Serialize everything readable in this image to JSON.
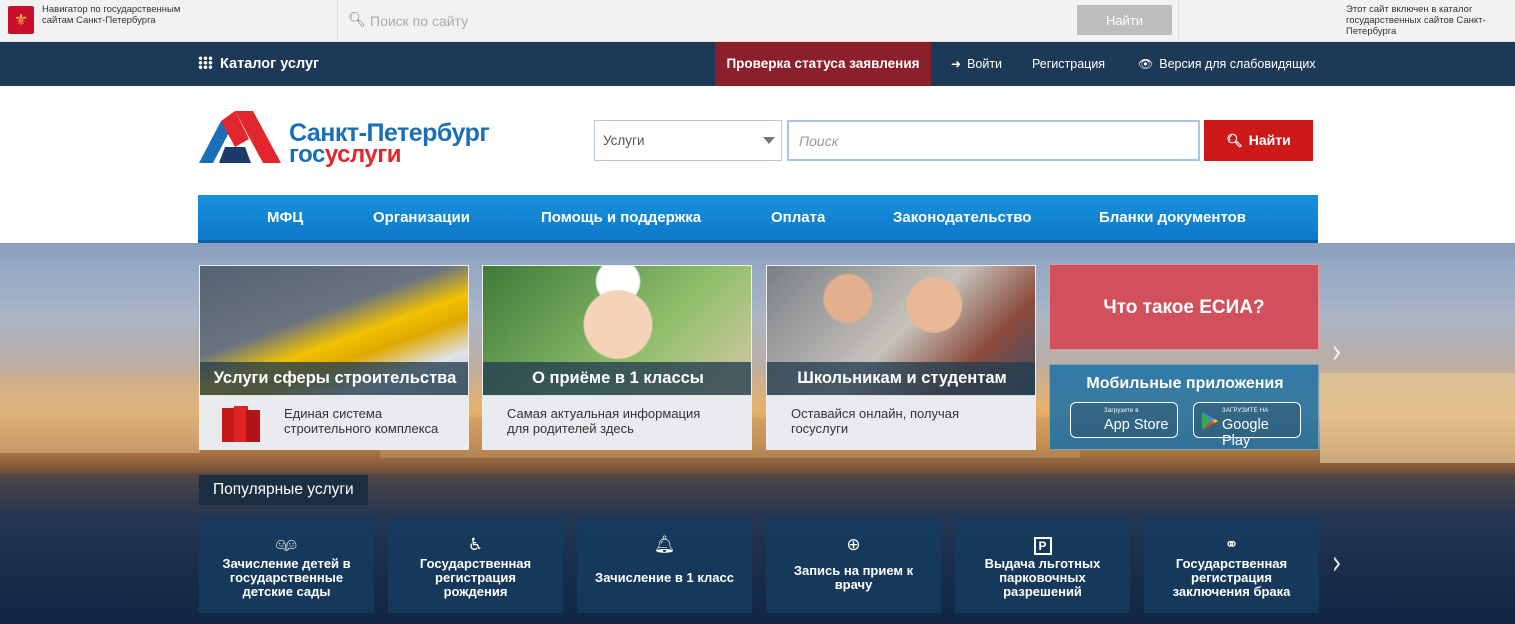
{
  "govbar": {
    "navigator_text": "Навигатор по государственным сайтам Санкт-Петербурга",
    "search_placeholder": "Поиск по сайту",
    "search_button": "Найти",
    "catalog_note": "Этот сайт включен в каталог государственных сайтов Санкт-Петербурга"
  },
  "topnav": {
    "catalog": "Каталог услуг",
    "status_check": "Проверка статуса заявления",
    "login": "Войти",
    "register": "Регистрация",
    "accessible": "Версия для слабовидящих"
  },
  "header": {
    "logo_line1": "Санкт-Петербург",
    "logo_line2_a": "гос",
    "logo_line2_b": "услуги",
    "select_value": "Услуги",
    "search_placeholder": "Поиск",
    "search_button": "Найти"
  },
  "mainnav": [
    "МФЦ",
    "Организации",
    "Помощь и поддержка",
    "Оплата",
    "Законодательство",
    "Бланки документов"
  ],
  "cards": [
    {
      "title": "Услуги сферы строительства",
      "desc1": "Единая система",
      "desc2": "строительного комплекса"
    },
    {
      "title": "О приёме в 1 классы",
      "desc1": "Самая актуальная информация",
      "desc2": "для родителей здесь"
    },
    {
      "title": "Школьникам и студентам",
      "desc1": "Оставайся онлайн, получая",
      "desc2": "госуслуги"
    }
  ],
  "esia": "Что такое ЕСИА?",
  "mobile": {
    "title": "Мобильные приложения",
    "appstore_small": "Загрузите в",
    "appstore": "App Store",
    "gplay_small": "ЗАГРУЗИТЕ НА",
    "gplay": "Google Play"
  },
  "popular": {
    "label": "Популярные услуги",
    "items": [
      {
        "icon": "children-icon",
        "lines": [
          "Зачисление детей в",
          "государственные",
          "детские сады"
        ]
      },
      {
        "icon": "stroller-icon",
        "lines": [
          "Государственная",
          "регистрация",
          "рождения"
        ]
      },
      {
        "icon": "bell-icon",
        "lines": [
          "Зачисление в 1 класс"
        ]
      },
      {
        "icon": "medical-bag-icon",
        "lines": [
          "Запись на прием к",
          "врачу"
        ]
      },
      {
        "icon": "parking-icon",
        "lines": [
          "Выдача льготных",
          "парковочных",
          "разрешений"
        ]
      },
      {
        "icon": "rings-icon",
        "lines": [
          "Государственная",
          "регистрация",
          "заключения брака"
        ]
      }
    ]
  },
  "colors": {
    "brand_blue": "#1b6eb8",
    "brand_red": "#e1262c",
    "dark_nav": "#1c3a55",
    "status_bg": "#8b1f2b"
  }
}
